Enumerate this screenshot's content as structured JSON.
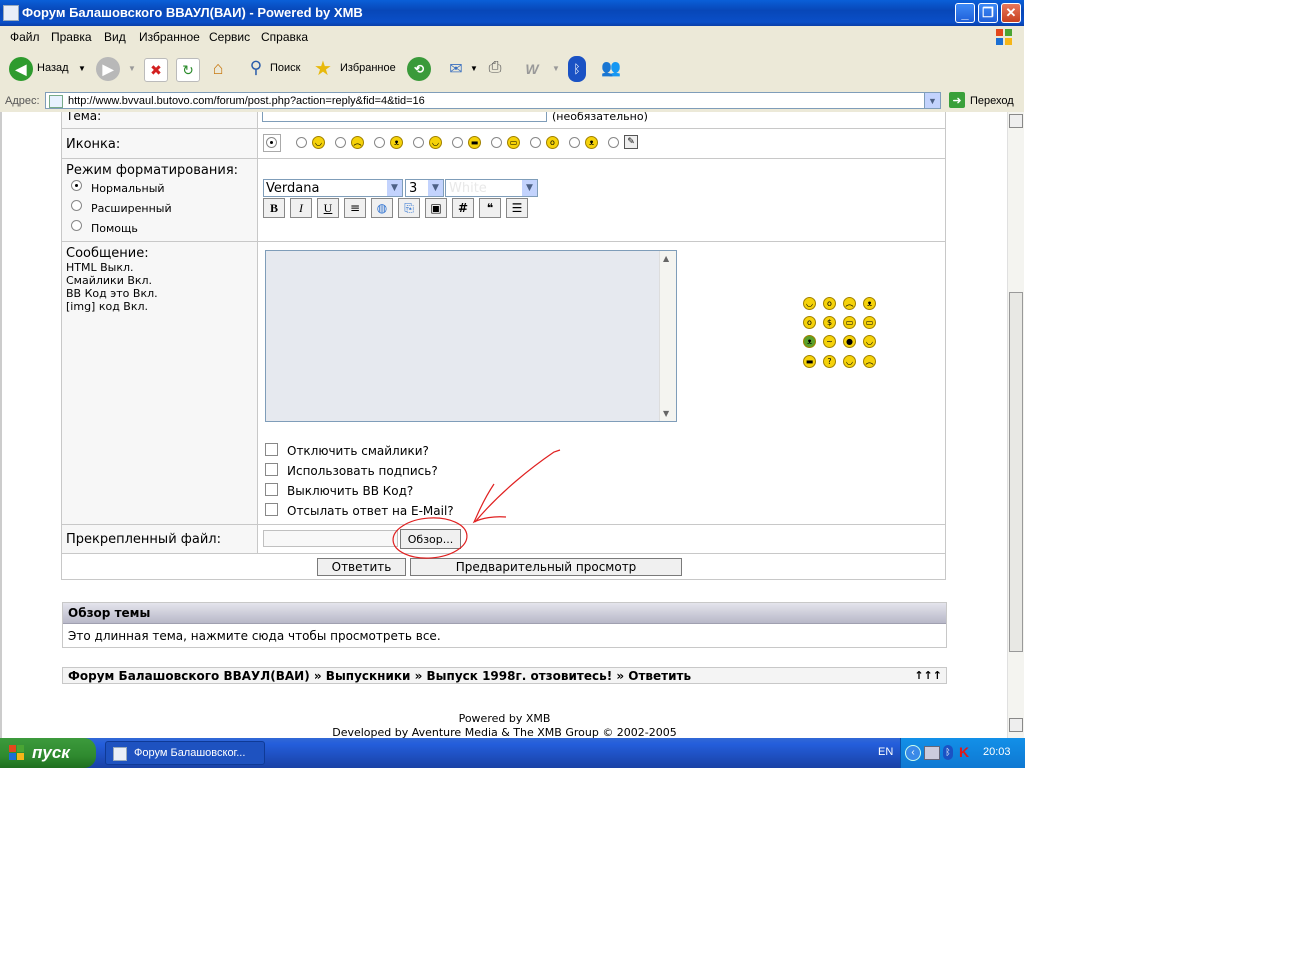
{
  "window": {
    "title": "Форум Балашовского ВВАУЛ(ВАИ) - Powered by XMB"
  },
  "menu": [
    "Файл",
    "Правка",
    "Вид",
    "Избранное",
    "Сервис",
    "Справка"
  ],
  "toolbar": {
    "back_label": "Назад",
    "search_label": "Поиск",
    "favorites_label": "Избранное"
  },
  "address": {
    "label": "Адрес:",
    "url": "http://www.bvvaul.butovo.com/forum/post.php?action=reply&fid=4&tid=16",
    "go_label": "Переход"
  },
  "form": {
    "subject_label": "Тема:",
    "subject_note": "(необязательно)",
    "icon_label": "Иконка:",
    "format_label": "Режим форматирования:",
    "format_options": [
      "Нормальный",
      "Расширенный",
      "Помощь"
    ],
    "font_value": "Verdana",
    "size_value": "3",
    "color_value": "White",
    "format_buttons": [
      "B",
      "I",
      "U"
    ],
    "message_label": "Сообщение:",
    "message_info": [
      "HTML Выкл.",
      "Смайлики Вкл.",
      "BB Код это Вкл.",
      "[img] код Вкл."
    ],
    "options": [
      "Отключить смайлики?",
      "Использовать подпись?",
      "Выключить BB Код?",
      "Отсылать ответ на E-Mail?"
    ],
    "attach_label": "Прекрепленный файл:",
    "browse_label": "Обзор...",
    "submit_label": "Ответить",
    "preview_label": "Предварительный просмотр"
  },
  "topic_review": {
    "header": "Обзор темы",
    "text": "Это длинная тема, нажмите сюда чтобы просмотреть все."
  },
  "breadcrumb": {
    "text": "Форум Балашовского ВВАУЛ(ВАИ)  » Выпускники » Выпуск 1998г. отзовитесь! » Ответить",
    "arrows": "↑↑↑"
  },
  "footer": {
    "line1": "Powered by XMB",
    "line2": "Developed by Aventure Media & The XMB Group © 2002-2005"
  },
  "taskbar": {
    "start_label": "пуск",
    "task_label": "Форум Балашовског...",
    "lang": "EN",
    "clock": "20:03"
  }
}
